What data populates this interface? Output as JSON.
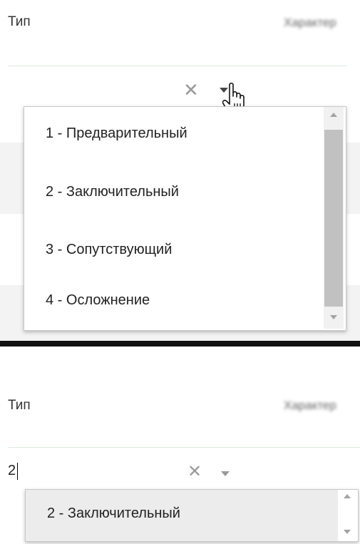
{
  "top_panel": {
    "field_label": "Тип",
    "neighbor_label_blurred": "Характер",
    "clear_icon": "close-icon",
    "caret_icon": "chevron-down-icon",
    "dropdown": {
      "options": [
        "1 - Предварительный",
        "2 - Заключительный",
        "3 - Сопутствующий",
        "4 - Осложнение"
      ]
    }
  },
  "bottom_panel": {
    "field_label": "Тип",
    "neighbor_label_blurred": "Характер",
    "input_value": "2",
    "clear_icon": "close-icon",
    "caret_icon": "chevron-down-icon",
    "dropdown": {
      "options": [
        "2 - Заключительный"
      ]
    }
  },
  "colors": {
    "divider": "#111111",
    "field_underline": "#dcebdc",
    "highlight": "#ececec",
    "scroll_thumb": "#c1c1c1"
  }
}
